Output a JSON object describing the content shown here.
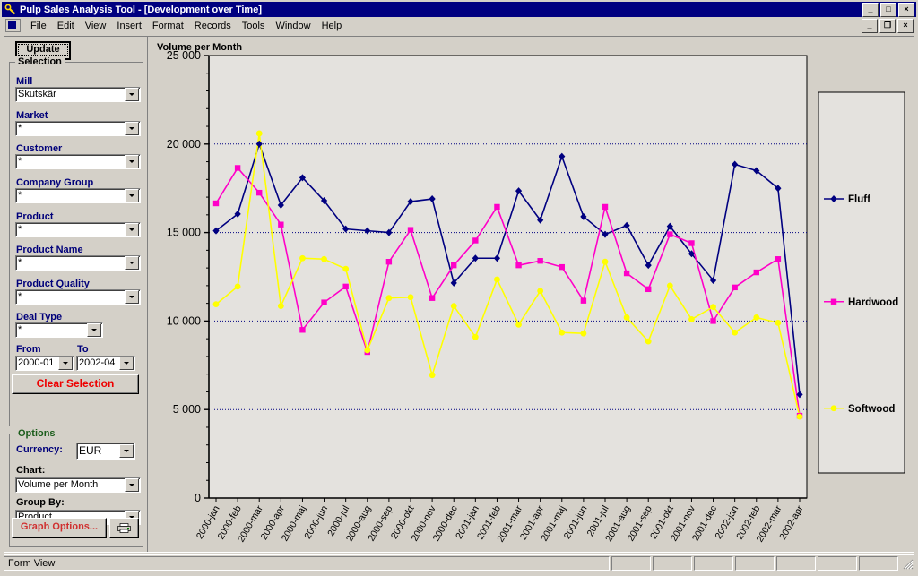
{
  "window": {
    "title": "Pulp Sales Analysis Tool - [Development over Time]",
    "app_icon": "wrench-key-icon",
    "controls": {
      "minimize": "_",
      "maximize": "□",
      "close": "×",
      "mdi_minimize": "_",
      "mdi_restore": "❐",
      "mdi_close": "×"
    }
  },
  "menubar": {
    "doc_icon": "document-window-icon",
    "items": [
      {
        "label": "File"
      },
      {
        "label": "Edit"
      },
      {
        "label": "View"
      },
      {
        "label": "Insert"
      },
      {
        "label": "Format"
      },
      {
        "label": "Records"
      },
      {
        "label": "Tools"
      },
      {
        "label": "Window"
      },
      {
        "label": "Help"
      }
    ]
  },
  "sidebar": {
    "update_button": "Update",
    "selection": {
      "title": "Selection",
      "fields": [
        {
          "label": "Mill",
          "value": "Skutskär",
          "name": "mill"
        },
        {
          "label": "Market",
          "value": "*",
          "name": "market"
        },
        {
          "label": "Customer",
          "value": "*",
          "name": "customer"
        },
        {
          "label": "Company Group",
          "value": "*",
          "name": "company-group"
        },
        {
          "label": "Product",
          "value": "*",
          "name": "product"
        },
        {
          "label": "Product Name",
          "value": "*",
          "name": "product-name"
        },
        {
          "label": "Product Quality",
          "value": "*",
          "name": "product-quality"
        },
        {
          "label": "Deal Type",
          "value": "*",
          "name": "deal-type"
        }
      ],
      "from_label": "From",
      "from_value": "2000-01",
      "to_label": "To",
      "to_value": "2002-04",
      "clear_button": "Clear Selection"
    },
    "options": {
      "title": "Options",
      "currency_label": "Currency:",
      "currency_value": "EUR",
      "chart_label": "Chart:",
      "chart_value": "Volume per Month",
      "groupby_label": "Group By:",
      "groupby_value": "Product",
      "graph_options_button": "Graph Options...",
      "print_button": "printer-icon"
    }
  },
  "statusbar": {
    "message": "Form View",
    "panes": [
      "",
      "",
      "",
      "",
      "",
      "",
      ""
    ],
    "grip": "resize-grip"
  },
  "chart_data": {
    "type": "line",
    "title": "Volume per Month",
    "xlabel": "",
    "ylabel": "",
    "ylim": [
      0,
      25000
    ],
    "ytick_interval": 5000,
    "yminor_interval": 1000,
    "ytick_labels": [
      "0",
      "5 000",
      "10 000",
      "15 000",
      "20 000",
      "25 000"
    ],
    "grid": true,
    "legend_position": "right",
    "categories": [
      "2000-jan",
      "2000-feb",
      "2000-mar",
      "2000-apr",
      "2000-maj",
      "2000-jun",
      "2000-jul",
      "2000-aug",
      "2000-sep",
      "2000-okt",
      "2000-nov",
      "2000-dec",
      "2001-jan",
      "2001-feb",
      "2001-mar",
      "2001-apr",
      "2001-maj",
      "2001-jun",
      "2001-jul",
      "2001-aug",
      "2001-sep",
      "2001-okt",
      "2001-nov",
      "2001-dec",
      "2002-jan",
      "2002-feb",
      "2002-mar",
      "2002-apr"
    ],
    "series": [
      {
        "name": "Fluff",
        "color": "#000080",
        "marker": "diamond",
        "values": [
          15100,
          16050,
          20000,
          16550,
          18100,
          16800,
          15200,
          15100,
          15000,
          16750,
          16900,
          12150,
          13550,
          13550,
          17350,
          15700,
          19300,
          15900,
          14900,
          15400,
          13150,
          15350,
          13800,
          12300,
          18850,
          18500,
          17500,
          5850
        ]
      },
      {
        "name": "Hardwood",
        "color": "#ff00c8",
        "marker": "square",
        "values": [
          16650,
          18650,
          17250,
          15450,
          9500,
          11050,
          11950,
          8250,
          13350,
          15150,
          11300,
          13150,
          14550,
          16450,
          13150,
          13400,
          13050,
          11150,
          16450,
          12700,
          11800,
          14900,
          14400,
          10000,
          11900,
          12750,
          13500,
          4650
        ]
      },
      {
        "name": "Softwood",
        "color": "#ffff00",
        "marker": "circle",
        "values": [
          10950,
          11950,
          20600,
          10850,
          13550,
          13500,
          12950,
          8350,
          11300,
          11350,
          6950,
          10850,
          9100,
          12350,
          9800,
          11700,
          9350,
          9300,
          13350,
          10200,
          8850,
          12000,
          10100,
          10800,
          9350,
          10200,
          9900,
          4600
        ]
      }
    ]
  }
}
